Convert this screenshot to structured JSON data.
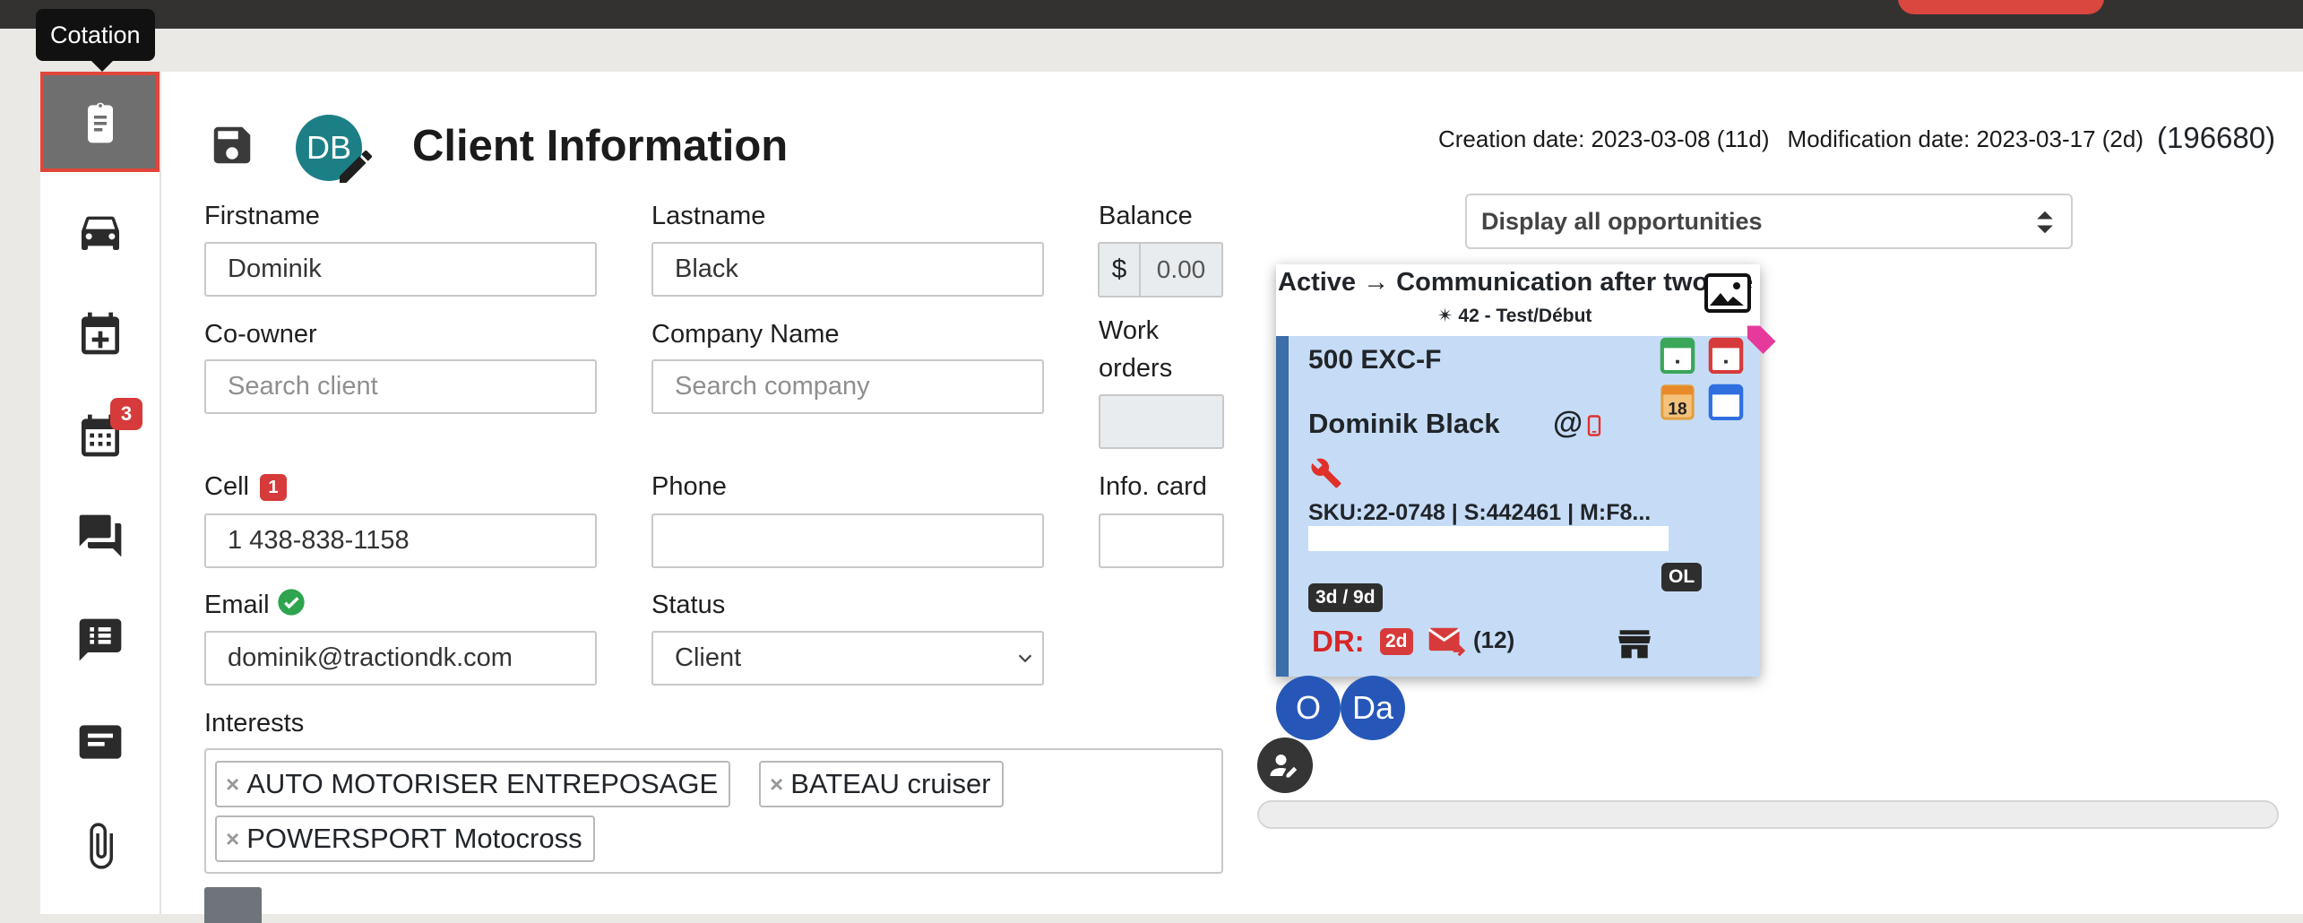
{
  "tooltip": "Cotation",
  "sidebar": {
    "items": [
      {
        "icon": "clipboard-icon",
        "active": true
      },
      {
        "icon": "car-icon"
      },
      {
        "icon": "calendar-plus-icon"
      },
      {
        "icon": "calendar-grid-icon",
        "badge": "3"
      },
      {
        "icon": "chat-bubbles-icon"
      },
      {
        "icon": "comment-list-icon"
      },
      {
        "icon": "card-icon"
      },
      {
        "icon": "paperclip-icon"
      }
    ]
  },
  "header": {
    "avatar_initials": "DB",
    "title": "Client Information",
    "creation_date": "Creation date: 2023-03-08 (11d)",
    "modification_date": "Modification date: 2023-03-17 (2d)",
    "client_id": "(196680)"
  },
  "form": {
    "firstname_label": "Firstname",
    "firstname_value": "Dominik",
    "lastname_label": "Lastname",
    "lastname_value": "Black",
    "balance_label": "Balance",
    "balance_currency": "$",
    "balance_value": "0.00",
    "coowner_label": "Co-owner",
    "coowner_placeholder": "Search client",
    "company_label": "Company Name",
    "company_placeholder": "Search company",
    "workorders_label": "Work orders",
    "cell_label": "Cell",
    "cell_badge": "1",
    "cell_value": "1 438-838-1158",
    "phone_label": "Phone",
    "phone_value": "",
    "infocard_label": "Info. card",
    "infocard_value": "",
    "email_label": "Email",
    "email_value": "dominik@tractiondk.com",
    "status_label": "Status",
    "status_value": "Client",
    "interests_label": "Interests",
    "interests": [
      "AUTO MOTORISER ENTREPOSAGE",
      "BATEAU cruiser",
      "POWERSPORT Motocross"
    ]
  },
  "opportunities": {
    "filter_value": "Display all opportunities",
    "card": {
      "heading": "Active → Communication after two me",
      "subheading": "✴ 42 - Test/Début",
      "vehicle": "500 EXC-F",
      "client_name": "Dominik Black",
      "email_symbol": "@",
      "sku_line": "SKU:22-0748 | S:442461 | M:F8...",
      "calendar_number": "18",
      "time_pill": "3d / 9d",
      "ol_pill": "OL",
      "dr_label": "DR:",
      "dr_badge": "2d",
      "message_count": "(12)"
    },
    "assignees": [
      "O",
      "Da"
    ],
    "progress": 0.0
  },
  "colors": {
    "accent_red": "#d73a3a",
    "card_blue": "#c6dcf6",
    "avatar_teal": "#1d7f86",
    "assignee_blue": "#2657b8"
  }
}
